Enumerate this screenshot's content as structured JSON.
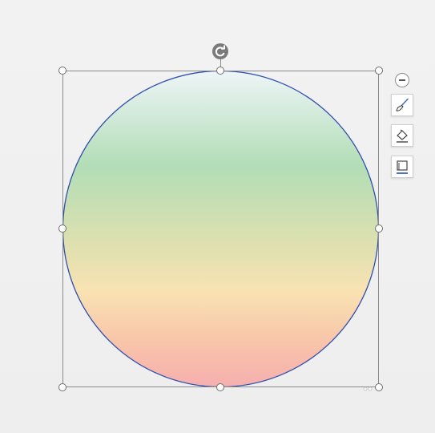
{
  "shape": {
    "type": "circle",
    "gradient_stops": [
      "#eef5f8",
      "#b2ddb6",
      "#d9e0b0",
      "#f9e2b2",
      "#f8c0aa",
      "#f6afae"
    ],
    "outline_color": "#2f4eb0"
  },
  "selection": {
    "handles": [
      "top-left",
      "top-center",
      "top-right",
      "middle-left",
      "middle-right",
      "bottom-left",
      "bottom-center",
      "bottom-right"
    ]
  },
  "toolbar": {
    "collapse_icon": "minus-circle-icon",
    "style_icon": "paintbrush-icon",
    "fill_icon": "paint-bucket-icon",
    "outline_icon": "shape-outline-icon",
    "accent_color": "#4a72c4"
  }
}
